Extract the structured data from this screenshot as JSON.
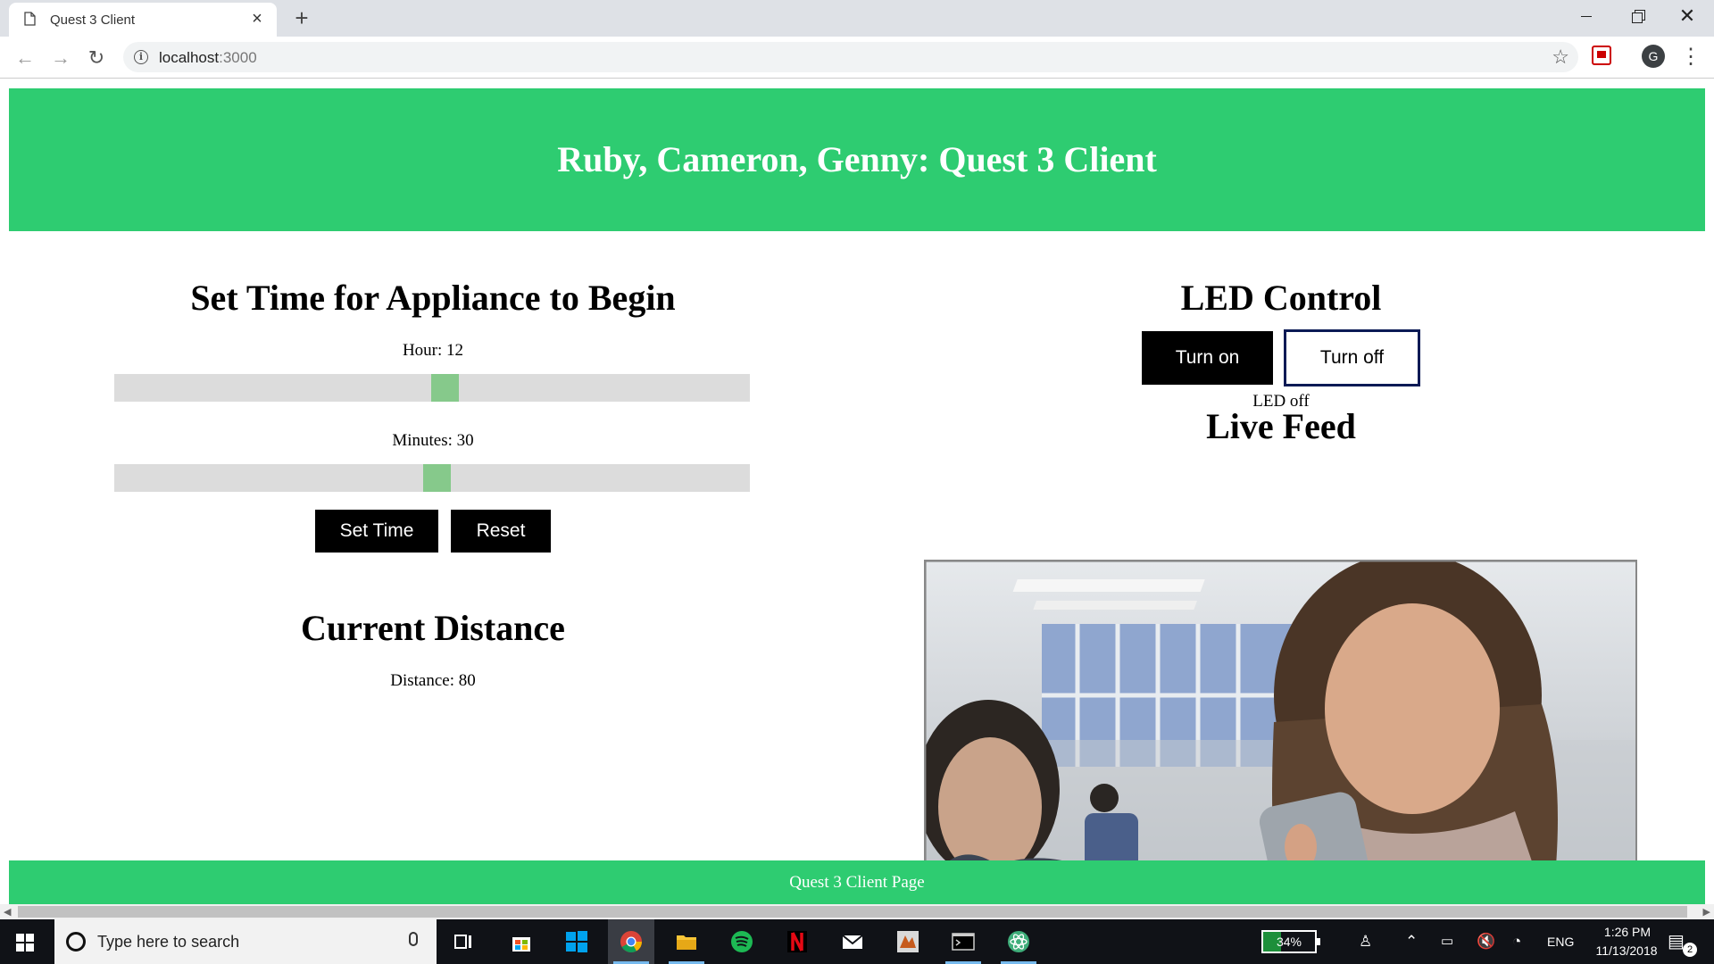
{
  "browser": {
    "tab_title": "Quest 3 Client",
    "url_host": "localhost",
    "url_port": ":3000",
    "profile_initial": "G"
  },
  "page": {
    "title": "Ruby, Cameron, Genny: Quest 3 Client",
    "accent_color": "#2ecc71",
    "set_time": {
      "heading": "Set Time for Appliance to Begin",
      "hour_label": "Hour: 12",
      "hour_value": 12,
      "hour_max": 23,
      "minutes_label": "Minutes: 30",
      "minutes_value": 30,
      "minutes_max": 59,
      "set_button": "Set Time",
      "reset_button": "Reset"
    },
    "distance": {
      "heading": "Current Distance",
      "value_label": "Distance: 80"
    },
    "led": {
      "heading": "LED Control",
      "on_button": "Turn on",
      "off_button": "Turn off",
      "status": "LED off"
    },
    "feed": {
      "heading": "Live Feed"
    },
    "footer": "Quest 3 Client Page"
  },
  "taskbar": {
    "search_placeholder": "Type here to search",
    "battery_percent": "34%",
    "battery_level": 0.34,
    "language": "ENG",
    "time": "1:26 PM",
    "date": "11/13/2018",
    "notification_count": "2",
    "apps": [
      "task-view",
      "store",
      "windows",
      "chrome",
      "file-explorer",
      "spotify",
      "netflix",
      "mail",
      "matlab",
      "terminal",
      "atom"
    ]
  }
}
